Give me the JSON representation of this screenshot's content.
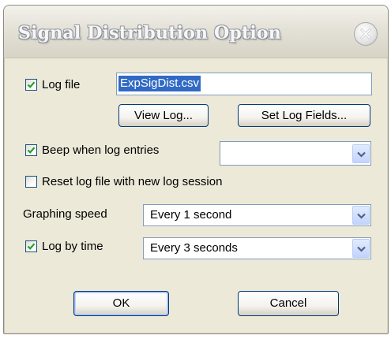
{
  "window": {
    "title": "Signal Distribution Option"
  },
  "log_file": {
    "label": "Log file",
    "checked": true,
    "value": "ExpSigDist.csv"
  },
  "buttons": {
    "view_log": "View Log...",
    "set_log_fields": "Set Log Fields...",
    "ok": "OK",
    "cancel": "Cancel"
  },
  "beep": {
    "label": "Beep when log entries",
    "checked": true,
    "selected": ""
  },
  "reset": {
    "label": "Reset log file with new log session",
    "checked": false
  },
  "graphing_speed": {
    "label": "Graphing speed",
    "selected": "Every 1 second"
  },
  "log_by_time": {
    "label": "Log by time",
    "checked": true,
    "selected": "Every 3 seconds"
  },
  "colors": {
    "accent": "#316ac5",
    "check": "#21a121",
    "dialog_bg": "#ece9d8"
  },
  "icons": {
    "close": "close-icon",
    "check": "checkmark-icon",
    "dropdown": "chevron-down-icon"
  }
}
